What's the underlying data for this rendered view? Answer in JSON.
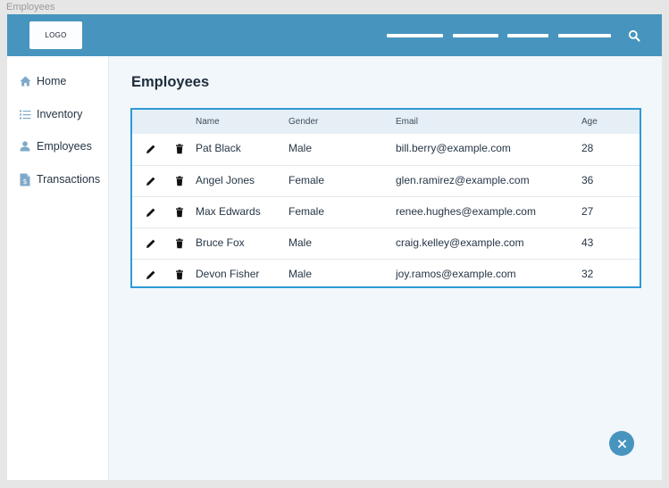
{
  "window": {
    "title": "Employees"
  },
  "header": {
    "logo": "LOGO",
    "nav_links": 4
  },
  "sidebar": {
    "items": [
      {
        "label": "Home",
        "icon": "home-icon"
      },
      {
        "label": "Inventory",
        "icon": "list-icon"
      },
      {
        "label": "Employees",
        "icon": "person-icon"
      },
      {
        "label": "Transactions",
        "icon": "document-dollar-icon"
      }
    ]
  },
  "main": {
    "title": "Employees",
    "table": {
      "columns": [
        "Name",
        "Gender",
        "Email",
        "Age"
      ],
      "rows": [
        {
          "name": "Pat Black",
          "gender": "Male",
          "email": "bill.berry@example.com",
          "age": "28"
        },
        {
          "name": "Angel Jones",
          "gender": "Female",
          "email": "glen.ramirez@example.com",
          "age": "36"
        },
        {
          "name": "Max Edwards",
          "gender": "Female",
          "email": "renee.hughes@example.com",
          "age": "27"
        },
        {
          "name": "Bruce Fox",
          "gender": "Male",
          "email": "craig.kelley@example.com",
          "age": "43"
        },
        {
          "name": "Devon Fisher",
          "gender": "Male",
          "email": "joy.ramos@example.com",
          "age": "32"
        }
      ]
    }
  },
  "colors": {
    "header": "#4795be",
    "accent": "#2d9ad7",
    "background": "#f2f7fb"
  }
}
